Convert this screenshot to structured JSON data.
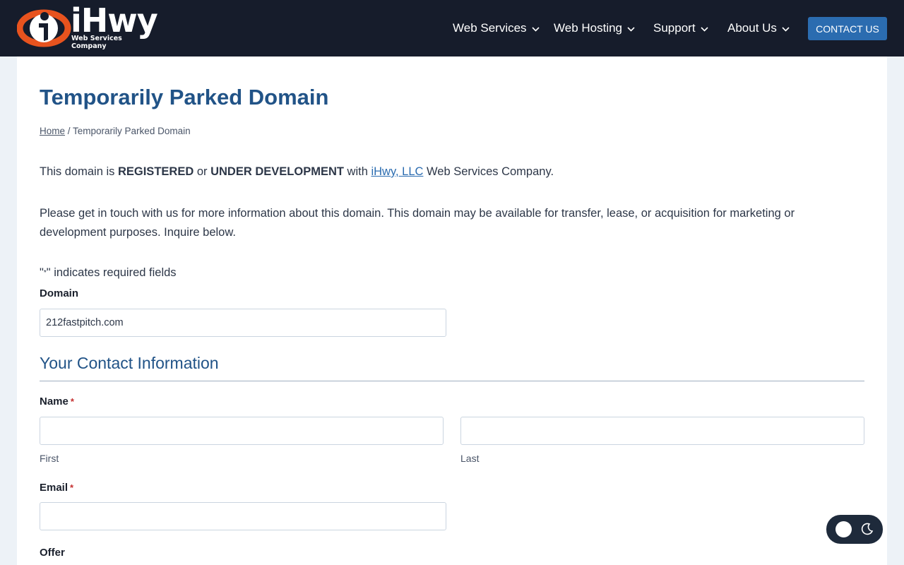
{
  "header": {
    "logo_word": "iHwy",
    "logo_subtitle": "Web Services Company",
    "nav": [
      {
        "label": "Web Services"
      },
      {
        "label": "Web Hosting"
      },
      {
        "label": "Support"
      },
      {
        "label": "About Us"
      }
    ],
    "contact_label": "CONTACT US"
  },
  "page": {
    "title": "Temporarily Parked Domain",
    "breadcrumb_home": "Home",
    "breadcrumb_separator": " / ",
    "breadcrumb_current": "Temporarily Parked Domain",
    "intro": {
      "p1": "This domain is ",
      "registered": "REGISTERED",
      "or": " or ",
      "under_dev": "UNDER DEVELOPMENT",
      "with": " with ",
      "link": "iHwy, LLC",
      "tail": " Web Services Company."
    },
    "paragraph2": "Please get in touch with us for more information about this domain. This domain may be available for transfer, lease, or acquisition for marketing or development purposes. Inquire below."
  },
  "form": {
    "required_note_open": "\"",
    "required_note_star": "*",
    "required_note_close": "\" indicates required fields",
    "domain_label": "Domain",
    "domain_value": "212fastpitch.com",
    "section_title": "Your Contact Information",
    "name_label": "Name",
    "required_marker": "*",
    "first_label": "First",
    "last_label": "Last",
    "first_value": "",
    "last_value": "",
    "email_label": "Email",
    "email_value": "",
    "offer_label": "Offer"
  },
  "colors": {
    "header_bg": "#161c2b",
    "title": "#215387",
    "accent": "#2b6cb0",
    "required": "#c53030",
    "logo_orange": "#e8531e"
  },
  "icons": {
    "logo": "ihwy-logo-icon",
    "nav_chevron": "chevron-down-icon",
    "theme_light": "sun-circle-icon",
    "theme_dark": "moon-icon"
  }
}
